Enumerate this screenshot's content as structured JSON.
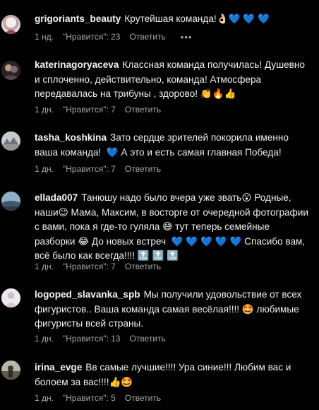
{
  "comments": [
    {
      "user": "grigoriants_beauty",
      "text": "Крутейшая команда!👌🏻💙 💙 💙",
      "time": "1 нд.",
      "likes": "\"Нравится\": 23",
      "reply": "Ответить",
      "more": "•••"
    },
    {
      "user": "katerinagoryaceva",
      "text": "Классная команда получилась! Душевно и сплоченно, действительно, команда! Атмосфера передавалась на трибуны , здорово! 👏🔥👍",
      "time": "1 дн.",
      "likes": "\"Нравится\": 7",
      "reply": "Ответить"
    },
    {
      "user": "tasha_koshkina",
      "text": "Зато сердце зрителей покорила именно ваша команда!  💙 А это и есть самая главная Победа!",
      "time": "1 дн.",
      "likes": "\"Нравится\": 7",
      "reply": "Ответить"
    },
    {
      "user": "ellada007",
      "text": "Танюшу надо было вчера уже звать😮 Родные, наши😉 Мама, Максим, в восторге от очередной фотографии с вами, пока я где-то гуляла 😅 тут теперь семейные разборки 😂 До новых встреч  💙 💙 💙 💙 💙 Спасибо вам, всё было как всегда!!!! 🔝 🔝 🔝",
      "time": "1 дн.",
      "likes": "\"Нравится\": 7",
      "reply": "Ответить"
    },
    {
      "user": "logoped_slavanka_spb",
      "text": "Мы получили удовольствие от всех фигуристов.. Ваша команда самая весёлая!!!! 🤩 любимые фигуристы всей страны.",
      "time": "1 дн.",
      "likes": "\"Нравится\": 13",
      "reply": "Ответить"
    },
    {
      "user": "irina_evge",
      "text": "Вв самые лучшие!!!! Ура синие!!! Любим вас и болоем за вас!!!!👍🤩",
      "time": "1 дн.",
      "likes": "\"Нравится\": 5",
      "reply": "Ответить"
    }
  ],
  "avatars": [
    {
      "icon": "avatar-photo-icon",
      "color": "#d9c7c9"
    },
    {
      "icon": "avatar-photo-icon",
      "color": "#5a4b4f"
    },
    {
      "icon": "avatar-photo-icon",
      "color": "#a8aeb2"
    },
    {
      "icon": "avatar-photo-icon",
      "color": "#5f7d8f"
    },
    {
      "icon": "avatar-photo-icon",
      "color": "#e3dce3"
    },
    {
      "icon": "avatar-photo-icon",
      "color": "#6f6a55"
    }
  ]
}
